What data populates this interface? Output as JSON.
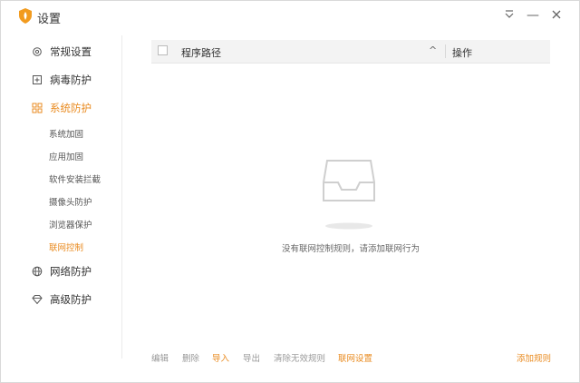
{
  "window": {
    "title": "设置",
    "accent_color": "#e98b20"
  },
  "titlebar": {
    "menu_icon": "dropdown-menu-icon",
    "minimize_label": "—",
    "close_icon": "close-icon"
  },
  "sidebar": {
    "items": [
      {
        "label": "常规设置",
        "icon": "gear-icon"
      },
      {
        "label": "病毒防护",
        "icon": "virus-shield-icon"
      },
      {
        "label": "系统防护",
        "icon": "system-grid-icon"
      },
      {
        "label": "网络防护",
        "icon": "globe-icon"
      },
      {
        "label": "高级防护",
        "icon": "diamond-icon"
      }
    ],
    "sub_items": [
      {
        "label": "系统加固"
      },
      {
        "label": "应用加固"
      },
      {
        "label": "软件安装拦截"
      },
      {
        "label": "摄像头防护"
      },
      {
        "label": "浏览器保护"
      },
      {
        "label": "联网控制"
      }
    ],
    "active_item": "系统防护",
    "active_sub_item": "联网控制"
  },
  "table": {
    "columns": [
      "程序路径",
      "操作"
    ],
    "rows": []
  },
  "empty_state": {
    "message": "没有联网控制规则，请添加联网行为"
  },
  "footer": {
    "edit_label": "编辑",
    "delete_label": "删除",
    "import_label": "导入",
    "export_label": "导出",
    "clear_invalid_label": "清除无效规则",
    "network_settings_label": "联网设置",
    "add_rule_label": "添加规则"
  }
}
